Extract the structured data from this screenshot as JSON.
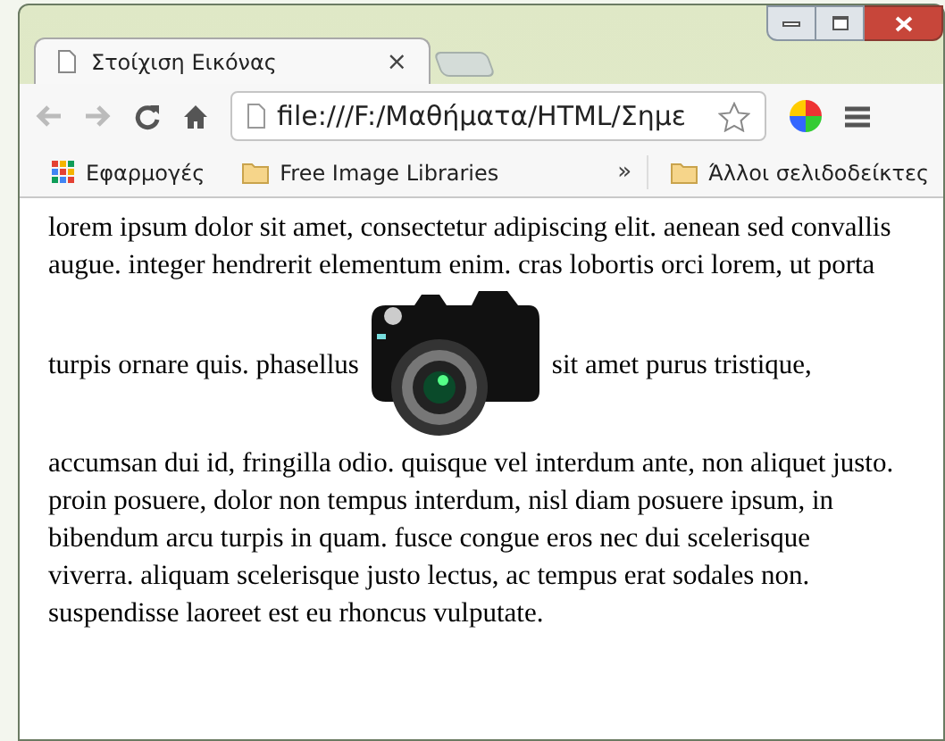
{
  "tab": {
    "title": "Στοίχιση Εικόνας",
    "close": "×"
  },
  "address_bar": {
    "value": "file:///F:/Μαθήματα/HTML/Σημε"
  },
  "bookmarks": [
    {
      "kind": "apps",
      "label": "Εφαρμογές"
    },
    {
      "kind": "folder",
      "label": "Free Image Libraries"
    }
  ],
  "bookmarks_overflow": "»",
  "other_bookmarks": "Άλλοι σελιδοδείκτες",
  "page": {
    "lines_before": [
      "lorem ipsum dolor sit amet, consectetur adipiscing elit. aenean sed convallis",
      "augue. integer hendrerit elementum enim. cras lobortis orci lorem, ut porta"
    ],
    "image_line": {
      "before": "turpis ornare quis. phasellus",
      "after": "sit amet purus tristique,"
    },
    "lines_after": [
      "accumsan dui id, fringilla odio. quisque vel interdum ante, non aliquet justo.",
      "proin posuere, dolor non tempus interdum, nisl diam posuere ipsum, in",
      "bibendum arcu turpis in quam. fusce congue eros nec dui scelerisque",
      "viverra. aliquam scelerisque justo lectus, ac tempus erat sodales non.",
      "suspendisse laoreet est eu rhoncus vulputate."
    ]
  }
}
